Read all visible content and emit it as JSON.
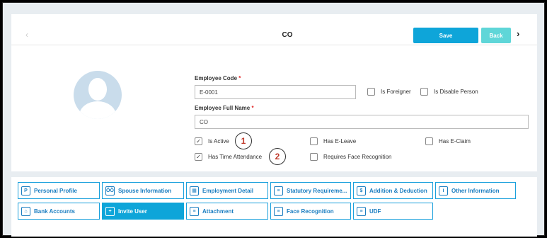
{
  "header": {
    "title": "CO",
    "save_label": "Save",
    "back_label": "Back",
    "prev_arrow": "‹",
    "next_arrow": "›"
  },
  "form": {
    "employee_code_label": "Employee Code",
    "employee_code_value": "E-0001",
    "full_name_label": "Employee Full Name",
    "full_name_value": "CO",
    "required_mark": "*",
    "checkboxes": {
      "is_foreigner": {
        "label": "Is Foreigner",
        "checked": false
      },
      "is_disable_person": {
        "label": "Is Disable Person",
        "checked": false
      },
      "is_active": {
        "label": "Is Active",
        "checked": true
      },
      "has_eleave": {
        "label": "Has E-Leave",
        "checked": false
      },
      "has_eclaim": {
        "label": "Has E-Claim",
        "checked": false
      },
      "has_time_attendance": {
        "label": "Has Time Attendance",
        "checked": true
      },
      "requires_face_recognition": {
        "label": "Requires Face Recognition",
        "checked": false
      }
    },
    "check_glyph": "✓"
  },
  "markers": {
    "one": "1",
    "two": "2"
  },
  "tabs": [
    {
      "label": "Personal Profile",
      "icon": "profile-icon",
      "glyph": "P"
    },
    {
      "label": "Spouse Information",
      "icon": "people-icon",
      "glyph": "ÖÖ"
    },
    {
      "label": "Employment Detail",
      "icon": "building-icon",
      "glyph": "▦"
    },
    {
      "label": "Statutory Requireme...",
      "icon": "document-icon",
      "glyph": "≡"
    },
    {
      "label": "Addition & Deduction",
      "icon": "coin-icon",
      "glyph": "$"
    },
    {
      "label": "Other Information",
      "icon": "info-icon",
      "glyph": "i"
    },
    {
      "label": "Bank Accounts",
      "icon": "bank-icon",
      "glyph": "⌂"
    },
    {
      "label": "Invite User",
      "icon": "user-add-icon",
      "glyph": "+"
    },
    {
      "label": "Attachment",
      "icon": "attachment-icon",
      "glyph": "≡"
    },
    {
      "label": "Face Recognition",
      "icon": "face-icon",
      "glyph": "≡"
    },
    {
      "label": "UDF",
      "icon": "udf-icon",
      "glyph": "≡"
    }
  ],
  "colors": {
    "accent": "#0ea5d9",
    "back": "#5fd6d8",
    "required": "#e02424"
  }
}
